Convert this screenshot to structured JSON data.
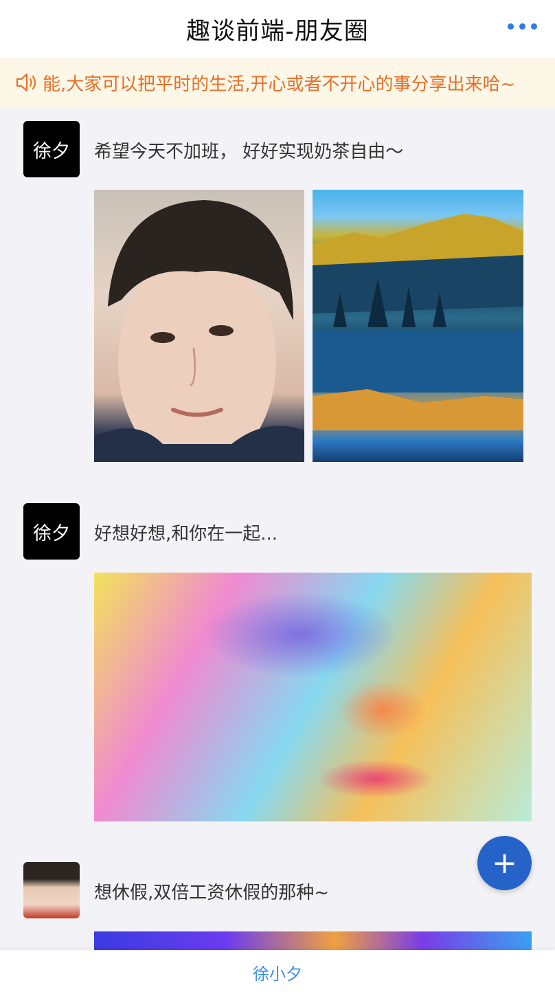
{
  "header": {
    "title": "趣谈前端-朋友圈",
    "more_icon": "more-dots-icon"
  },
  "notice": {
    "icon": "speaker-icon",
    "text": "能,大家可以把平时的生活,开心或者不开心的事分享出来哈~"
  },
  "posts": [
    {
      "avatar_text": "徐夕",
      "text": "希望今天不加班， 好好实现奶茶自由～",
      "images": [
        "portrait-photo",
        "lake-landscape-photo"
      ]
    },
    {
      "avatar_text": "徐夕",
      "text": "好想好想,和你在一起...",
      "images": [
        "colorful-face-art"
      ]
    },
    {
      "avatar_text": "",
      "text": "想休假,双倍工资休假的那种~",
      "images": [
        "gradient-image"
      ]
    }
  ],
  "fab": {
    "label": "+",
    "icon": "plus-icon"
  },
  "tabbar": {
    "label": "徐小夕"
  },
  "colors": {
    "accent": "#2663c8",
    "notice_text": "#e5702a",
    "notice_bg": "#fdf7e7",
    "tab_text": "#3d8ee6"
  }
}
